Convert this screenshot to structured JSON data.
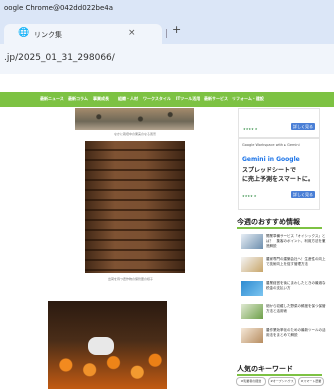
{
  "window": {
    "title": "oogle Chrome@042dd022be4a"
  },
  "tab": {
    "title": "リンク集",
    "close": "×",
    "new_tab": "+"
  },
  "address": {
    "url": ".jp/2025_01_31_298066/"
  },
  "nav": {
    "items": [
      "最新ニュース",
      "最新コラム",
      "事業成長",
      "組織・人材",
      "ワークスタイル",
      "ITツール活用",
      "最新サービス",
      "リフォーム・建設"
    ]
  },
  "article": {
    "caption1": "なかに栽培中の果実のなる風景",
    "caption2": "出荷を待つ農作物の保管庫の様子"
  },
  "sidebar": {
    "ad_top": {
      "button": "詳しく見る",
      "meta": "★★★★ ★"
    },
    "gws": {
      "head": "Google Workspace with ▸ Gemini",
      "logo": "Gemini in Google",
      "line1": "スプレッドシートで",
      "line2": "に売上予測をスマートに。",
      "meta": "★★★★ ★",
      "button": "詳しく見る"
    },
    "recommend": {
      "title": "今週のおすすめ情報",
      "items": [
        "開業準備サービス「オイシックス」とは？　集客のポイント、利用方法を徹底解説",
        "農家専門の建築会社へ！生産性の向上で技術向上を促す管理方法",
        "農業経営を後にまわしたときの最適な税金の支払い方",
        "畑から収穫した野菜の鮮度を保つ保管方法と活用術",
        "農作業効率化のための最新ツールの活用法をまとめて解説"
      ]
    },
    "keywords": {
      "title": "人気のキーワード",
      "tags": [
        "#乳業者の経営",
        "#オープンハウス",
        "#スマート農業"
      ]
    }
  },
  "colors": {
    "accent": "#7dc243",
    "chrome": "#dbe6f7",
    "ad_button": "#4a7fd6"
  }
}
